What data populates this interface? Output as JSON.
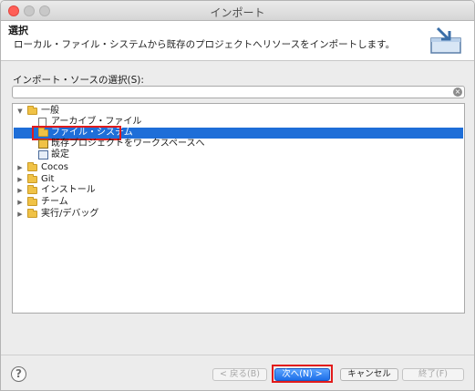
{
  "window": {
    "title": "インポート"
  },
  "header": {
    "title": "選択",
    "description": "ローカル・ファイル・システムから既存のプロジェクトへリソースをインポートします。",
    "icon": "import-wizard-icon"
  },
  "source": {
    "label": "インポート・ソースの選択(S):",
    "filter_value": "",
    "clear_icon": "clear-icon"
  },
  "tree": {
    "items": [
      {
        "label": "一般",
        "expanded": true,
        "icon": "folder-open-icon"
      },
      {
        "label": "アーカイブ・ファイル",
        "icon": "archive-file-icon"
      },
      {
        "label": "ファイル・システム",
        "icon": "folder-icon",
        "selected": true
      },
      {
        "label": "既存プロジェクトをワークスペースへ",
        "icon": "project-icon"
      },
      {
        "label": "設定",
        "icon": "settings-icon"
      },
      {
        "label": "Cocos",
        "expanded": false,
        "icon": "folder-icon"
      },
      {
        "label": "Git",
        "expanded": false,
        "icon": "folder-icon"
      },
      {
        "label": "インストール",
        "expanded": false,
        "icon": "folder-icon"
      },
      {
        "label": "チーム",
        "expanded": false,
        "icon": "folder-icon"
      },
      {
        "label": "実行/デバッグ",
        "expanded": false,
        "icon": "folder-icon"
      }
    ]
  },
  "footer": {
    "help": "?",
    "back_label": "< 戻る(B)",
    "next_label": "次へ(N) >",
    "cancel_label": "キャンセル",
    "finish_label": "終了(F)"
  },
  "colors": {
    "selection": "#1e6ed8",
    "highlight": "#e21b1b",
    "primary_button": "#1e6fe8"
  }
}
